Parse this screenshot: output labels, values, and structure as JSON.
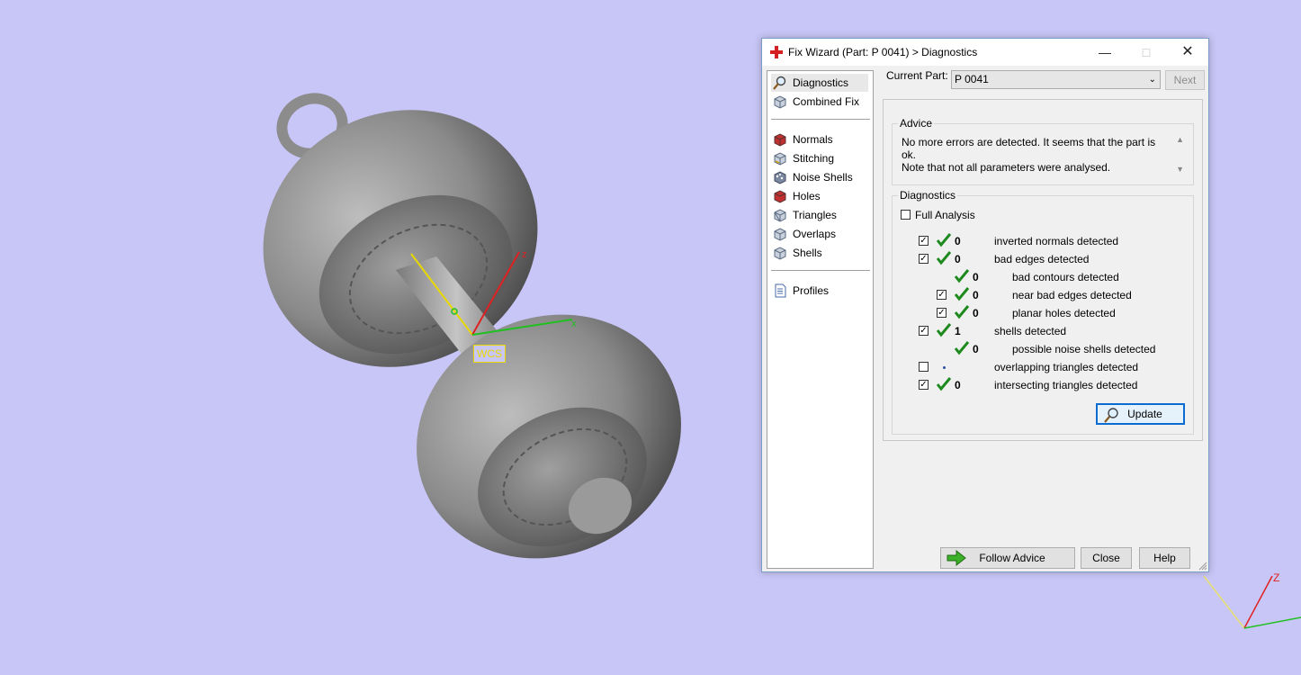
{
  "viewport": {
    "wcs_label": "WCS",
    "axis_x": "x",
    "axis_z": "z",
    "corner_axis_z": "Z"
  },
  "dialog": {
    "title": "Fix Wizard (Part: P 0041) > Diagnostics",
    "nav": {
      "top": [
        {
          "label": "Diagnostics",
          "icon": "magnifier-icon"
        },
        {
          "label": "Combined Fix",
          "icon": "cube-icon"
        }
      ],
      "middle": [
        {
          "label": "Normals",
          "icon": "normals-cube-icon"
        },
        {
          "label": "Stitching",
          "icon": "stitching-cube-icon"
        },
        {
          "label": "Noise Shells",
          "icon": "noise-shells-icon"
        },
        {
          "label": "Holes",
          "icon": "holes-cube-icon"
        },
        {
          "label": "Triangles",
          "icon": "triangles-cube-icon"
        },
        {
          "label": "Overlaps",
          "icon": "overlaps-cube-icon"
        },
        {
          "label": "Shells",
          "icon": "shells-cube-icon"
        }
      ],
      "bottom": [
        {
          "label": "Profiles",
          "icon": "document-icon"
        }
      ]
    },
    "current_part_label": "Current Part:",
    "current_part_value": "P 0041",
    "next_label": "Next",
    "advice": {
      "title": "Advice",
      "line1": "No more errors are detected. It seems that the part is ok.",
      "line2": "Note that not all parameters were analysed."
    },
    "diagnostics": {
      "title": "Diagnostics",
      "full_analysis_label": "Full Analysis",
      "rows": [
        {
          "count": "0",
          "label": "inverted normals detected"
        },
        {
          "count": "0",
          "label": "bad edges detected"
        },
        {
          "count": "0",
          "label": "bad contours detected"
        },
        {
          "count": "0",
          "label": "near bad edges detected"
        },
        {
          "count": "0",
          "label": "planar holes detected"
        },
        {
          "count": "1",
          "label": "shells detected"
        },
        {
          "count": "0",
          "label": "possible noise shells detected"
        },
        {
          "count": "",
          "label": "overlapping triangles detected"
        },
        {
          "count": "0",
          "label": "intersecting triangles detected"
        }
      ],
      "update_label": "Update"
    },
    "buttons": {
      "follow_advice": "Follow Advice",
      "close": "Close",
      "help": "Help"
    }
  }
}
